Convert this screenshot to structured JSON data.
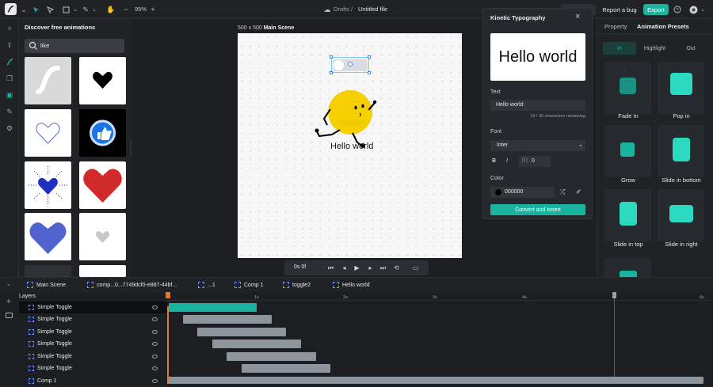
{
  "topbar": {
    "zoom": "95%",
    "breadcrumb_folder": "Drafts",
    "breadcrumb_sep": "/",
    "file_name": "Untitled file",
    "report_bug": "Report a bug",
    "export": "Export"
  },
  "left_panel": {
    "title": "Discover free animations",
    "search_value": "like"
  },
  "canvas": {
    "scene_size": "500 x 500",
    "scene_name": "Main Scene",
    "artboard_text": "Hello world"
  },
  "playbar": {
    "time": "0s 0f"
  },
  "modal": {
    "title": "Kinetic Typography",
    "preview_text": "Hello world",
    "text_label": "Text",
    "text_value": "Hello world",
    "char_count": "19 / 30 characters remaining",
    "font_label": "Font",
    "font_value": "Inter",
    "bold": "B",
    "italic": "I",
    "spacing_value": "0",
    "color_label": "Color",
    "color_value": "000000",
    "convert_button": "Convert and Insert"
  },
  "right_panel": {
    "tab_property": "Property",
    "tab_presets": "Animation Presets",
    "seg_in": "In",
    "seg_highlight": "Highlight",
    "seg_out": "Out",
    "presets": [
      "Fade In",
      "Pop in",
      "Grow",
      "Slide in bottom",
      "Slide in top",
      "Slide in right"
    ]
  },
  "timeline": {
    "tabs": [
      "Main Scene",
      "comp...0...7749dcf0-e887-44bf...",
      "...1",
      "Comp 1",
      "toggle2",
      "Hello world"
    ],
    "layers_label": "Layers",
    "layers": [
      "Simple Toggle",
      "Simple Toggle",
      "Simple Toggle",
      "Simple Toggle",
      "Simple Toggle",
      "Simple Toggle",
      "Comp 1"
    ],
    "ticks": [
      "1s",
      "2s",
      "3s",
      "4s",
      "6s"
    ]
  },
  "colors": {
    "accent": "#19b3a0",
    "bar_gray": "#8c949c",
    "dark": "#1c1e21"
  }
}
